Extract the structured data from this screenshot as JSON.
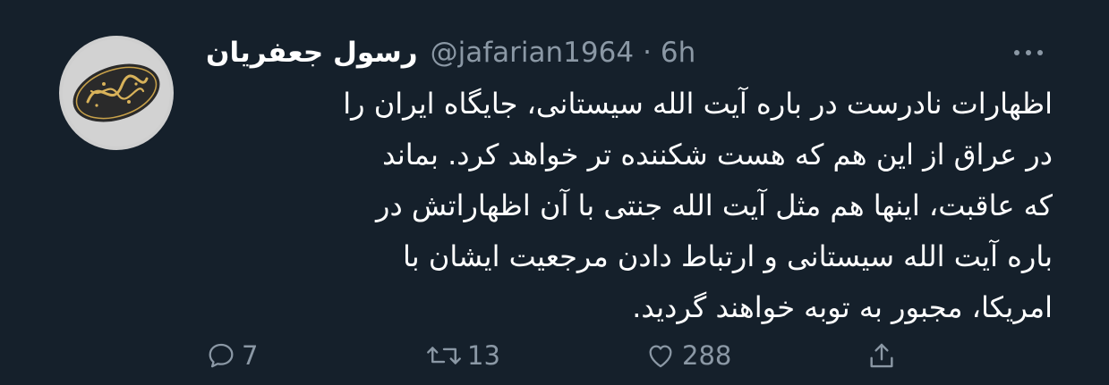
{
  "tweet": {
    "display_name": "رسول جعفریان",
    "handle": "@jafarian1964",
    "separator": "·",
    "time": "6h",
    "text_lines": [
      "اظهارات نادرست در باره آیت الله سیستانی، جایگاه ایران را",
      "در عراق از این هم که هست شکننده تر خواهد کرد. بماند",
      "که عاقبت، اینها هم مثل آیت الله جنتی با آن اظهاراتش در",
      "باره آیت الله سیستانی و ارتباط دادن مرجعیت ایشان با",
      "امریکا، مجبور به توبه خواهند گردید."
    ],
    "avatar_text": "رسول جعفریان"
  },
  "actions": {
    "reply_count": "7",
    "retweet_count": "13",
    "like_count": "288"
  },
  "icons": {
    "reply": "reply-icon",
    "retweet": "retweet-icon",
    "like": "heart-icon",
    "share": "share-icon",
    "more": "more-icon"
  },
  "colors": {
    "background": "#15202b",
    "text": "#ffffff",
    "secondary": "#8b98a5"
  }
}
